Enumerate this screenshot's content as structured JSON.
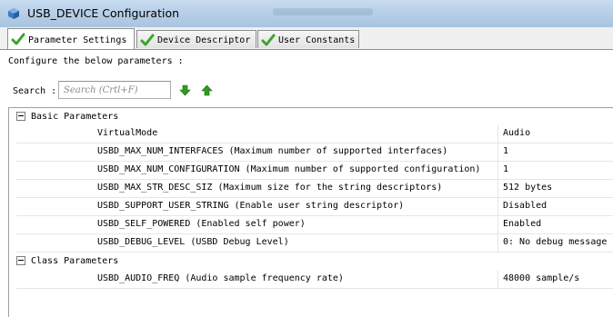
{
  "window": {
    "title": "USB_DEVICE Configuration"
  },
  "tabs": [
    {
      "label": "Parameter Settings",
      "active": true
    },
    {
      "label": "Device Descriptor",
      "active": false
    },
    {
      "label": "User Constants",
      "active": false
    }
  ],
  "description": "Configure the below parameters :",
  "search": {
    "label": "Search :",
    "placeholder": "Search (Crtl+F)"
  },
  "groups": [
    {
      "name": "Basic Parameters",
      "params": [
        {
          "name": "VirtualMode",
          "value": "Audio"
        },
        {
          "name": "USBD_MAX_NUM_INTERFACES (Maximum number of supported interfaces)",
          "value": "1"
        },
        {
          "name": "USBD_MAX_NUM_CONFIGURATION (Maximum number of supported configuration)",
          "value": "1"
        },
        {
          "name": "USBD_MAX_STR_DESC_SIZ (Maximum size for the string descriptors)",
          "value": "512 bytes"
        },
        {
          "name": "USBD_SUPPORT_USER_STRING (Enable user string descriptor)",
          "value": "Disabled"
        },
        {
          "name": "USBD_SELF_POWERED (Enabled self power)",
          "value": "Enabled"
        },
        {
          "name": "USBD_DEBUG_LEVEL (USBD Debug Level)",
          "value": "0: No debug message"
        }
      ]
    },
    {
      "name": "Class Parameters",
      "params": [
        {
          "name": "USBD_AUDIO_FREQ (Audio sample frequency rate)",
          "value": "48000 sample/s"
        }
      ]
    }
  ],
  "icons": {
    "window": "cube-icon",
    "tab_status": "checkmark-icon",
    "down": "arrow-down-icon",
    "up": "arrow-up-icon",
    "group_toggle": "collapse-icon"
  },
  "colors": {
    "check_green": "#3aa42a",
    "arrow_green": "#2f9a1f",
    "titlebar": "#b9d1ea"
  }
}
